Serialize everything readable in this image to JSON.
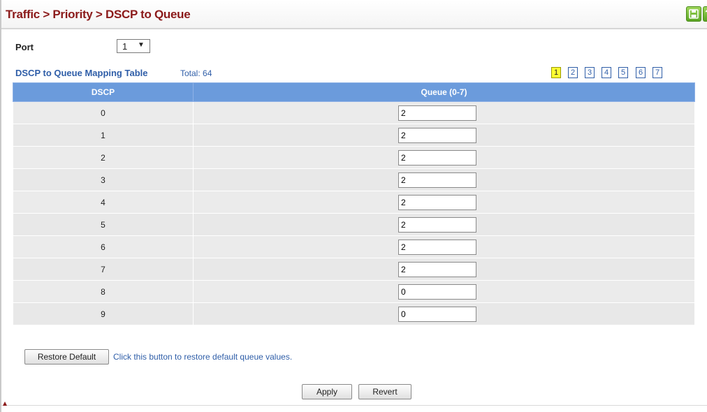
{
  "header": {
    "title": "Traffic > Priority > DSCP to Queue"
  },
  "icons": {
    "save": "save-icon",
    "help": "help-icon"
  },
  "port": {
    "label": "Port",
    "selected": "1",
    "arrow": "▼"
  },
  "table": {
    "title": "DSCP to Queue Mapping Table",
    "total": "Total: 64",
    "pages": [
      "1",
      "2",
      "3",
      "4",
      "5",
      "6",
      "7"
    ],
    "active_page": "1",
    "columns": [
      "DSCP",
      "Queue (0-7)"
    ],
    "rows": [
      {
        "dscp": "0",
        "queue": "2"
      },
      {
        "dscp": "1",
        "queue": "2"
      },
      {
        "dscp": "2",
        "queue": "2"
      },
      {
        "dscp": "3",
        "queue": "2"
      },
      {
        "dscp": "4",
        "queue": "2"
      },
      {
        "dscp": "5",
        "queue": "2"
      },
      {
        "dscp": "6",
        "queue": "2"
      },
      {
        "dscp": "7",
        "queue": "2"
      },
      {
        "dscp": "8",
        "queue": "0"
      },
      {
        "dscp": "9",
        "queue": "0"
      }
    ]
  },
  "actions": {
    "restore_label": "Restore Default",
    "restore_hint": "Click this button to restore default queue values.",
    "apply_label": "Apply",
    "revert_label": "Revert"
  },
  "colors": {
    "title": "#8b1a1a",
    "accent": "#2f5ea8",
    "header_bg": "#6b9bdc",
    "active_page": "#ffff33"
  }
}
